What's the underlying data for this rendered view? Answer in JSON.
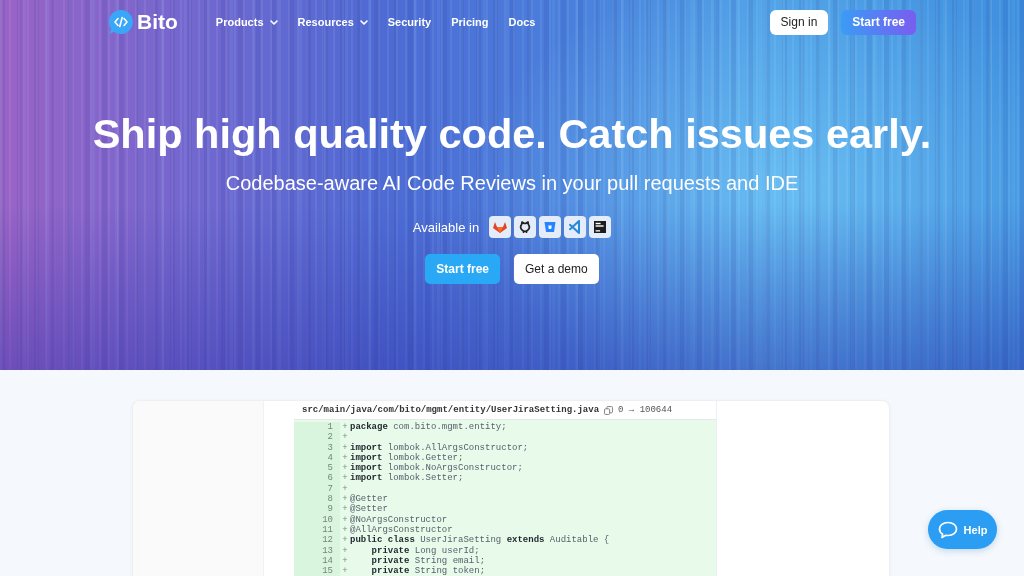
{
  "nav": {
    "logo": "Bito",
    "items": [
      {
        "label": "Products",
        "dropdown": true
      },
      {
        "label": "Resources",
        "dropdown": true
      },
      {
        "label": "Security",
        "dropdown": false
      },
      {
        "label": "Pricing",
        "dropdown": false
      },
      {
        "label": "Docs",
        "dropdown": false
      }
    ],
    "buttons": [
      {
        "label": "Sign in",
        "kind": "secondary"
      },
      {
        "label": "Start free",
        "kind": "gradient"
      }
    ]
  },
  "hero": {
    "title": "Ship high quality code. Catch issues early.",
    "subtitle": "Codebase-aware AI Code Reviews in your pull requests and IDE",
    "available_label": "Available in",
    "buttons": [
      {
        "label": "Start free",
        "kind": "primary"
      },
      {
        "label": "Get a demo",
        "kind": "secondary"
      }
    ]
  },
  "code_review": {
    "file_path": "src/main/java/com/bito/mgmt/entity/UserJiraSetting.java",
    "file_mode": "0 → 100644",
    "lines": [
      {
        "number": "1",
        "marker": "+",
        "code": "**package** com.bito.mgmt.entity;"
      },
      {
        "number": "2",
        "marker": "+"
      },
      {
        "number": "3",
        "marker": "+",
        "code": "**import** lombok.AllArgsConstructor;"
      },
      {
        "number": "4",
        "marker": "+",
        "code": "**import** lombok.Getter;"
      },
      {
        "number": "5",
        "marker": "+",
        "code": "**import** lombok.NoArgsConstructor;"
      },
      {
        "number": "6",
        "marker": "+",
        "code": "**import** lombok.Setter;"
      },
      {
        "number": "7",
        "marker": "+"
      },
      {
        "number": "8",
        "marker": "+",
        "code": "@Getter"
      },
      {
        "number": "9",
        "marker": "+",
        "code": "@Setter"
      },
      {
        "number": "10",
        "marker": "+",
        "code": "@NoArgsConstructor"
      },
      {
        "number": "11",
        "marker": "+",
        "code": "@AllArgsConstructor"
      },
      {
        "number": "12",
        "marker": "+",
        "code": "**public class** UserJiraSetting **extends** Auditable {"
      },
      {
        "number": "13",
        "marker": "+",
        "code": "    **private** Long userId;"
      },
      {
        "number": "14",
        "marker": "+",
        "code": "    **private** String email;"
      },
      {
        "number": "15",
        "marker": "+",
        "code": "    **private** String token;"
      }
    ]
  },
  "help_button": {
    "label": "Help"
  }
}
